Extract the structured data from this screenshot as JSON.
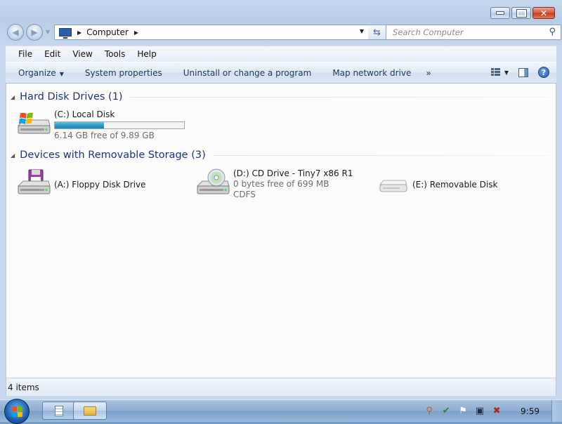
{
  "window": {
    "caption_buttons": [
      "minimize",
      "maximize",
      "close"
    ]
  },
  "address": {
    "location": "Computer",
    "search_placeholder": "Search Computer"
  },
  "menu": [
    {
      "label": "File"
    },
    {
      "label": "Edit"
    },
    {
      "label": "View"
    },
    {
      "label": "Tools"
    },
    {
      "label": "Help"
    }
  ],
  "commands": {
    "organize": "Organize",
    "system_properties": "System properties",
    "uninstall": "Uninstall or change a program",
    "map_drive": "Map network drive",
    "more": "»"
  },
  "groups": {
    "hard_disks": {
      "title": "Hard Disk Drives (1)",
      "items": [
        {
          "name": "(C:) Local Disk",
          "free_text": "6.14 GB free of 9.89 GB",
          "used_fraction": 0.38,
          "icon": "windows-drive-icon"
        }
      ]
    },
    "removable": {
      "title": "Devices with Removable Storage (3)",
      "items": [
        {
          "name": "(A:) Floppy Disk Drive",
          "icon": "floppy-drive-icon"
        },
        {
          "name": "(D:) CD Drive - Tiny7 x86 R1",
          "free_text": "0 bytes free of 699 MB",
          "filesystem": "CDFS",
          "icon": "cd-drive-icon"
        },
        {
          "name": "(E:) Removable Disk",
          "icon": "removable-disk-icon"
        }
      ]
    }
  },
  "status": {
    "items_count": "4 items"
  },
  "taskbar": {
    "clock": "9:59"
  },
  "colors": {
    "group_title": "#1e3287",
    "capacity_fill": "#2797ca",
    "close_button": "#c43b1c"
  }
}
